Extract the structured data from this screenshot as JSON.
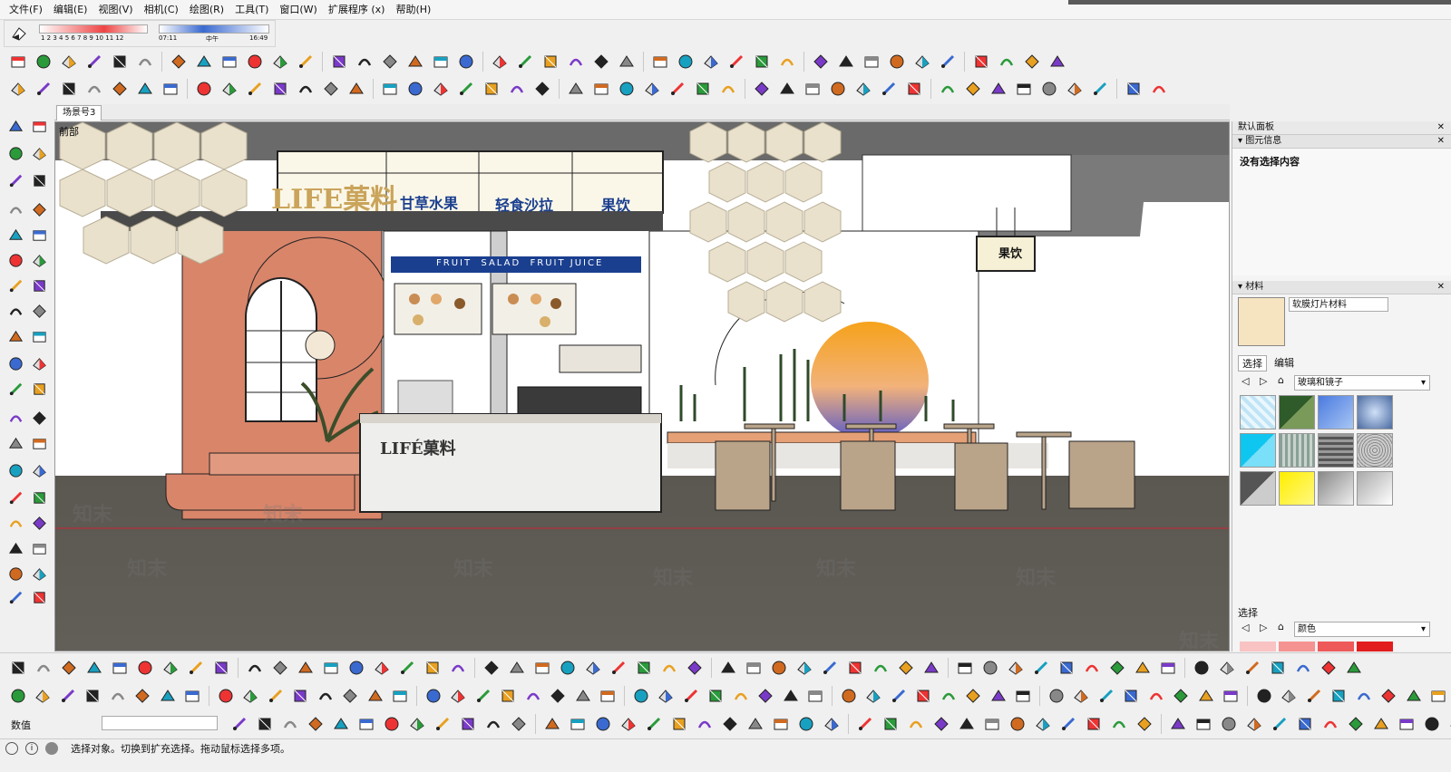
{
  "menus": [
    "文件(F)",
    "编辑(E)",
    "视图(V)",
    "相机(C)",
    "绘图(R)",
    "工具(T)",
    "窗口(W)",
    "扩展程序 (x)",
    "帮助(H)"
  ],
  "shadow": {
    "month_ticks": "1 2 3 4 5 6 7 8 9 10 11 12",
    "time_start": "07:11",
    "time_mid": "中午",
    "time_end": "16:49"
  },
  "scene_tab": "场景号3",
  "view_label": "前部",
  "scene": {
    "brand": "LIFE菓料",
    "sign1": "甘草水果",
    "sign2": "轻食沙拉",
    "sign3": "果饮",
    "banner": "FRUIT  SALAD  FRUIT JUICE",
    "hanging_sign": "果饮",
    "counter_logo": "LIFÉ菓料",
    "watermark": "知末"
  },
  "panel": {
    "title": "默认面板",
    "entity_info": "图元信息",
    "no_selection": "没有选择内容",
    "materials": "材料",
    "material_name": "软膜灯片材料",
    "tab_select": "选择",
    "tab_edit": "编辑",
    "library": "玻璃和镜子",
    "select2": "选择",
    "library2": "颜色"
  },
  "status": {
    "measure_label": "数值",
    "hint": "选择对象。切换到扩充选择。拖动鼠标选择多项。"
  },
  "colors": {
    "wall": "#d9856a",
    "floor": "#5e5a55",
    "accent": "#1a3f8f",
    "wood": "#b9a48a"
  }
}
